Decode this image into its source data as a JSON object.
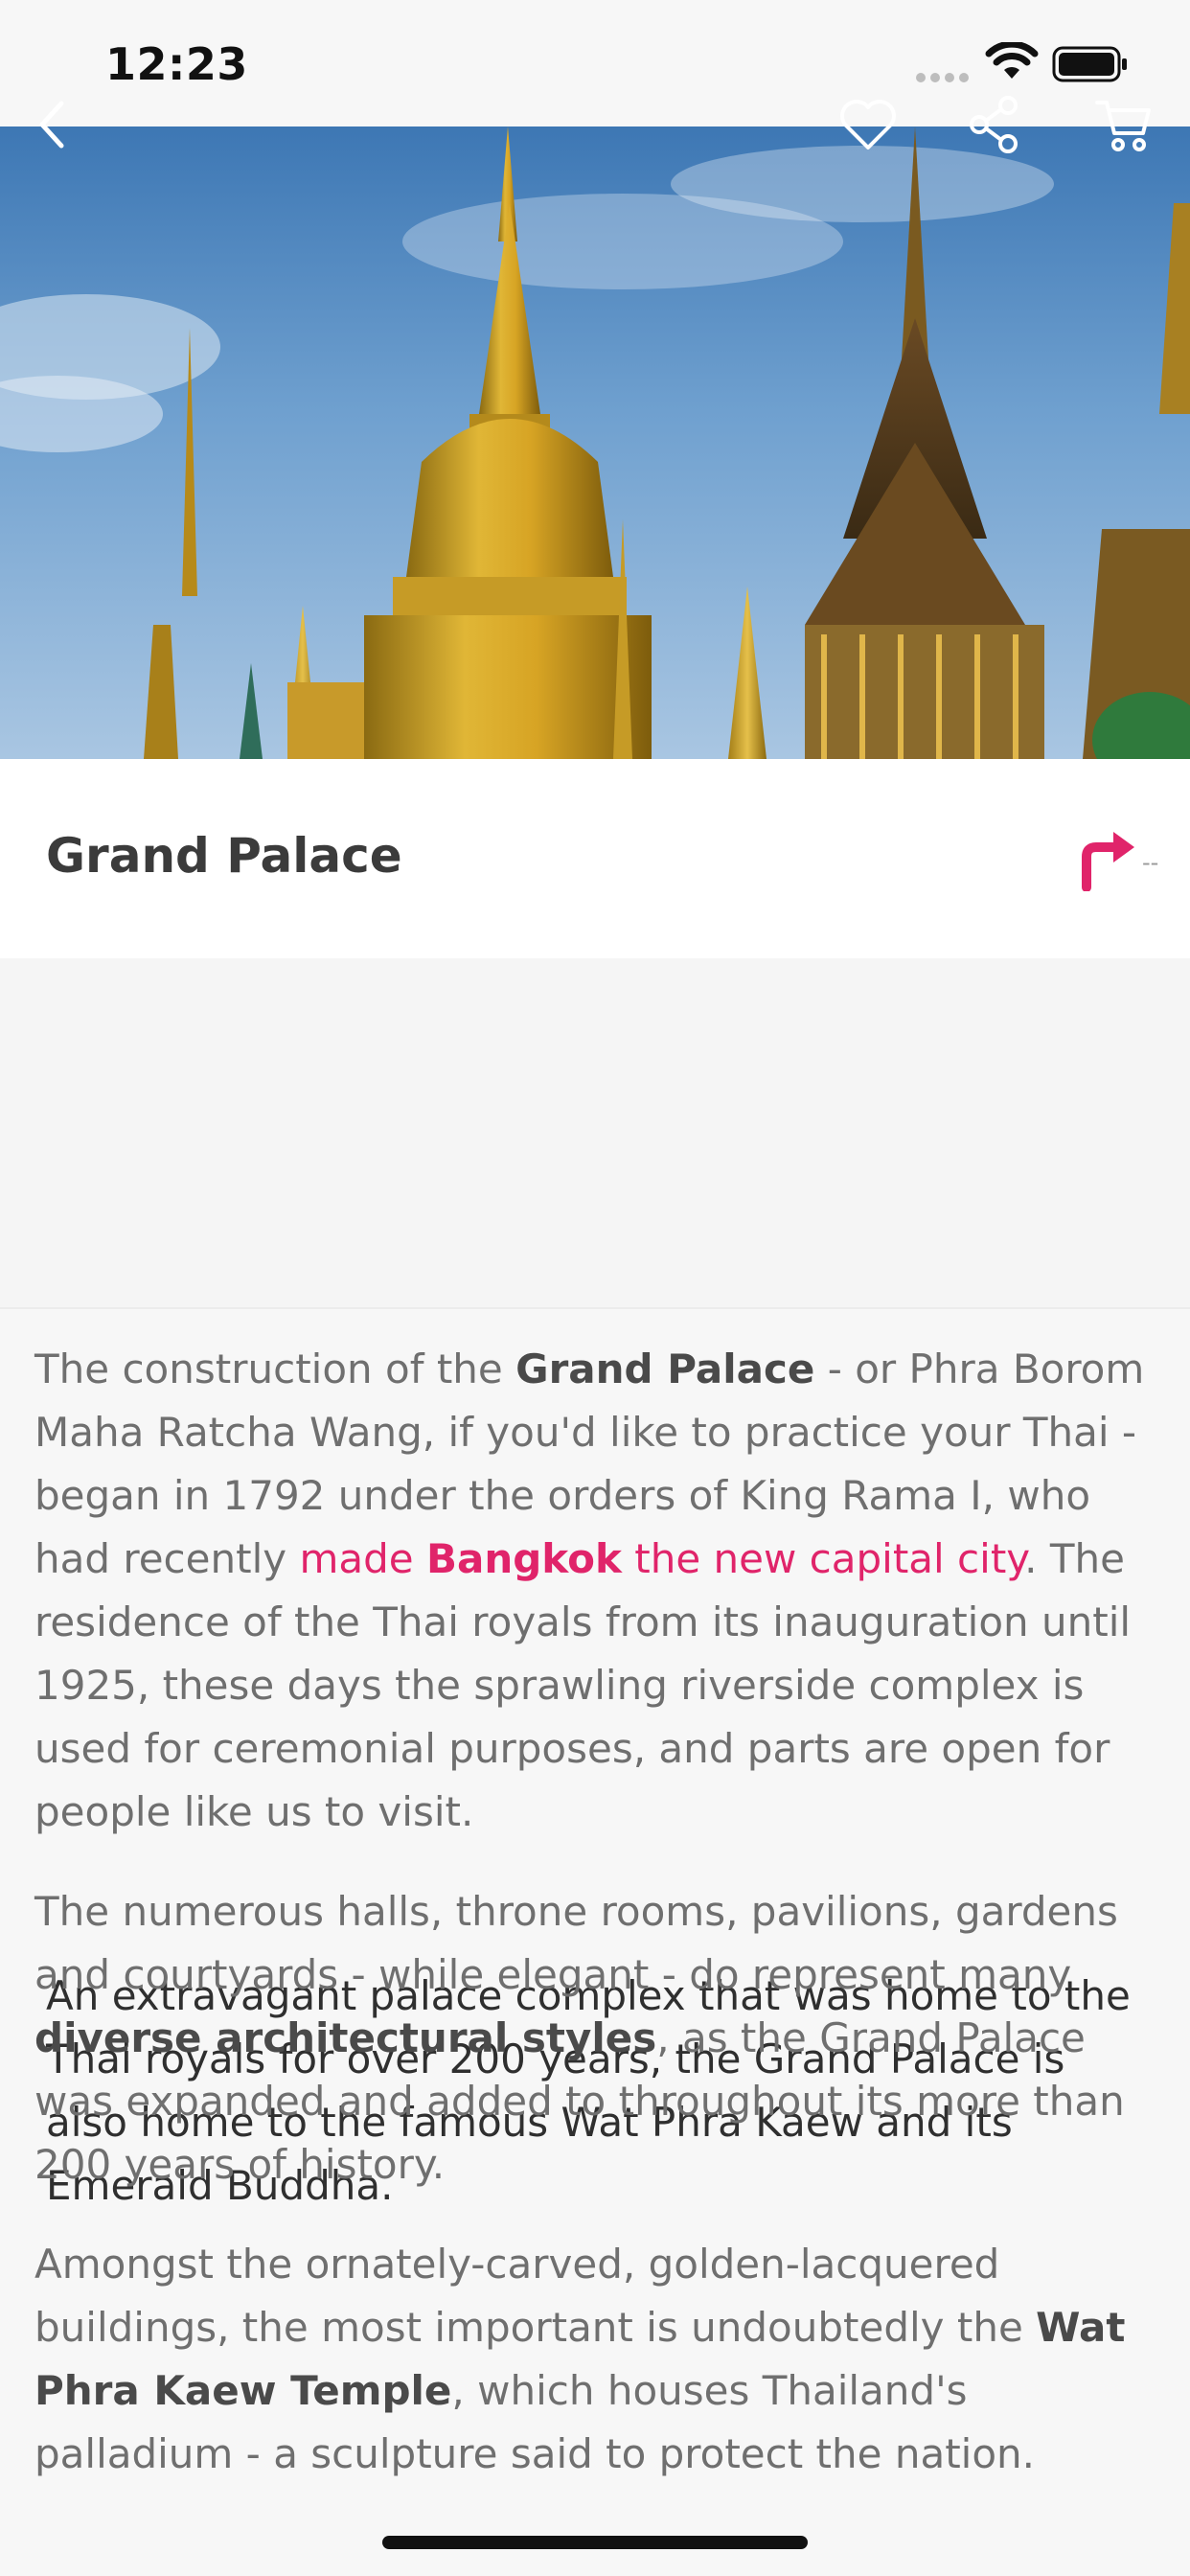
{
  "status_bar": {
    "time": "12:23"
  },
  "nav": {
    "back_icon": "chevron-left-icon",
    "favorite_icon": "heart-icon",
    "share_icon": "share-icon",
    "cart_icon": "cart-icon"
  },
  "place": {
    "title": "Grand Palace",
    "distance": "--"
  },
  "lead": "An extravagant palace complex that was home to the Thai royals for over 200 years, the Grand Palace is also home to the famous Wat Phra Kaew and its Emerald Buddha.",
  "article": {
    "p1": {
      "t1": "The construction of the ",
      "b1": "Grand Palace",
      "t2": " - or Phra Borom Maha Ratcha Wang, if you'd like to practice your Thai - began in 1792 under the orders of King Rama I, who had recently ",
      "link_pre": "made ",
      "link_bold": "Bangkok",
      "link_post": " the new capital city",
      "t3": ". The residence of the Thai royals from its inauguration until 1925, these days the sprawling riverside complex is used for ceremonial purposes, and parts are open for people like us to visit."
    },
    "p2": {
      "t1": "The numerous halls, throne rooms, pavilions, gardens and courtyards - while elegant - do represent many ",
      "b1": "diverse architectural styles",
      "t2": ", as the Grand Palace was expanded and added to throughout its more than 200 years of history."
    },
    "p3": {
      "t1": "Amongst the ornately-carved, golden-lacquered buildings, the most important is undoubtedly the ",
      "b1": "Wat Phra Kaew Temple",
      "t2": ", which houses Thailand's palladium - a sculpture said to protect the nation."
    }
  },
  "colors": {
    "accent": "#e0246a",
    "background": "#f7f7f7"
  }
}
